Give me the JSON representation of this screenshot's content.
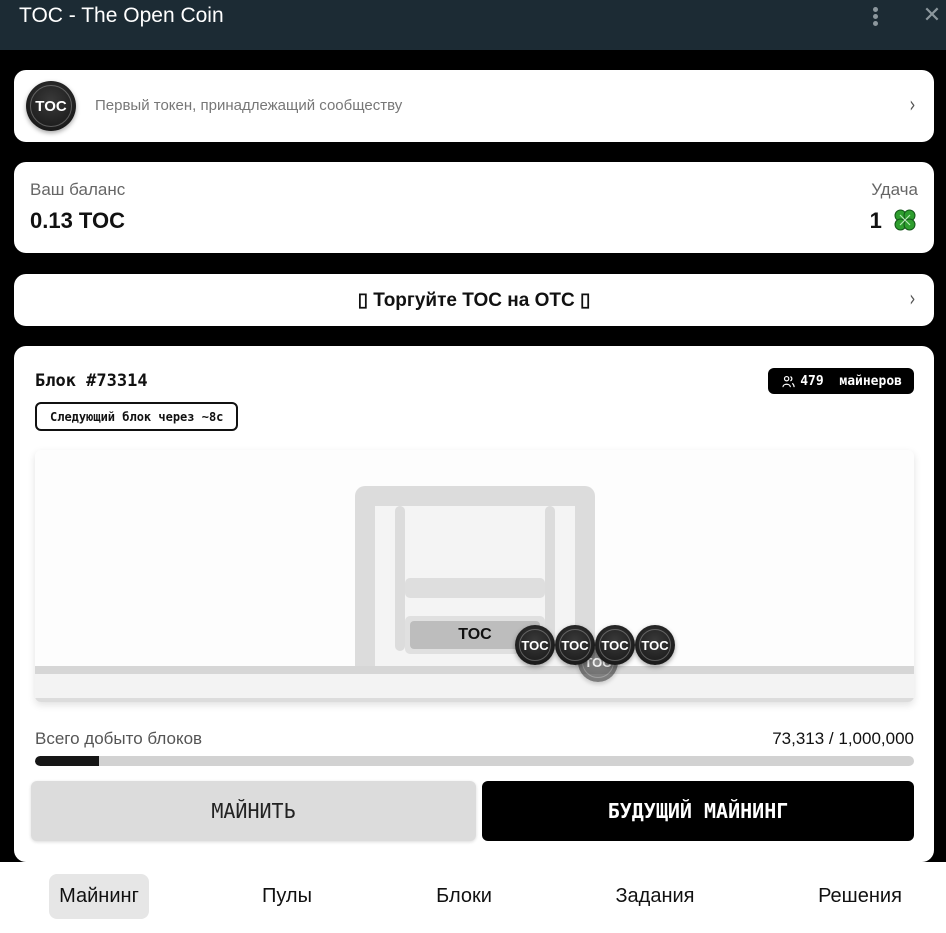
{
  "window": {
    "title": "TOC - The Open Coin",
    "menu_icon": "more-vertical-icon",
    "close_icon": "close-icon",
    "close_glyph": "✕"
  },
  "token": {
    "coin_label": "TOC",
    "tagline": "Первый токен, принадлежащий сообществу",
    "chevron": "›"
  },
  "balance": {
    "label": "Ваш баланс",
    "value": "0.13 TOC",
    "luck_label": "Удача",
    "luck_value": "1",
    "luck_icon": "four-leaf-clover-icon"
  },
  "trade": {
    "label": "▯ Торгуйте TOC на OTC ▯",
    "chevron": "›"
  },
  "mining": {
    "block_title": "Блок  #73314",
    "miners_count": "479",
    "miners_label": "майнеров",
    "next_block": "Следующий  блок  через  ~8с",
    "machine_label": "TOC",
    "coins": [
      "TOC",
      "TOC",
      "TOC",
      "TOC"
    ],
    "falling_coin": "TOC",
    "mined_label": "Всего добыто блоков",
    "mined_value": "73,313 / 1,000,000",
    "mined_fraction": 0.073313,
    "mine_button": "МАЙНИТЬ",
    "future_button": "БУДУЩИЙ  МАЙНИНГ"
  },
  "nav": {
    "items": [
      {
        "label": "Майнинг",
        "active": true
      },
      {
        "label": "Пулы",
        "active": false
      },
      {
        "label": "Блоки",
        "active": false
      },
      {
        "label": "Задания",
        "active": false
      },
      {
        "label": "Решения",
        "active": false
      }
    ]
  },
  "colors": {
    "titlebar": "#1c2b34",
    "background": "#000000",
    "card": "#ffffff",
    "accent": "#000000",
    "clover": "#2e9e2e"
  }
}
